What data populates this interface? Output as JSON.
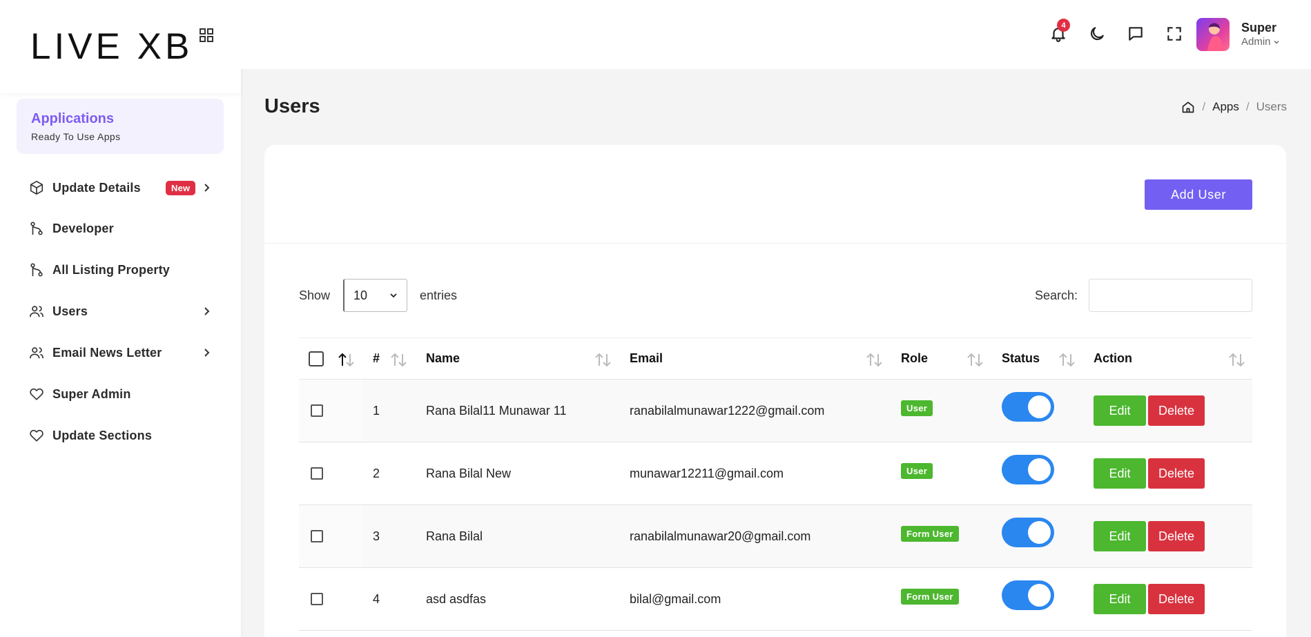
{
  "brand": {
    "logo_text": "LIVE XB"
  },
  "sidebar": {
    "apps_title": "Applications",
    "apps_subtitle": "Ready To Use Apps",
    "items": [
      {
        "label": "Update Details",
        "icon": "box-icon",
        "badge": "New",
        "chevron": true
      },
      {
        "label": "Developer",
        "icon": "git-branch-icon",
        "chevron": false
      },
      {
        "label": "All Listing Property",
        "icon": "git-branch-icon",
        "chevron": false
      },
      {
        "label": "Users",
        "icon": "users-icon",
        "chevron": true
      },
      {
        "label": "Email News Letter",
        "icon": "users-icon",
        "chevron": true
      },
      {
        "label": "Super Admin",
        "icon": "heart-icon",
        "chevron": false
      },
      {
        "label": "Update Sections",
        "icon": "heart-icon",
        "chevron": false
      }
    ]
  },
  "header": {
    "notification_count": "4",
    "user_name": "Super",
    "user_role": "Admin"
  },
  "page": {
    "title": "Users",
    "breadcrumb": [
      "Apps",
      "Users"
    ]
  },
  "card": {
    "add_button": "Add User",
    "show_label": "Show",
    "entries_value": "10",
    "entries_label": "entries",
    "search_label": "Search:",
    "search_value": ""
  },
  "table": {
    "columns": [
      "#",
      "Name",
      "Email",
      "Role",
      "Status",
      "Action"
    ],
    "edit_label": "Edit",
    "delete_label": "Delete",
    "rows": [
      {
        "id": "1",
        "name": "Rana Bilal11 Munawar 11",
        "email": "ranabilalmunawar1222@gmail.com",
        "role": "User",
        "status_on": true
      },
      {
        "id": "2",
        "name": "Rana Bilal New",
        "email": "munawar12211@gmail.com",
        "role": "User",
        "status_on": true
      },
      {
        "id": "3",
        "name": "Rana Bilal",
        "email": "ranabilalmunawar20@gmail.com",
        "role": "Form User",
        "status_on": true
      },
      {
        "id": "4",
        "name": "asd asdfas",
        "email": "bilal@gmail.com",
        "role": "Form User",
        "status_on": true
      }
    ]
  },
  "colors": {
    "accent": "#7360f2",
    "edit": "#4cb72f",
    "delete": "#d9323f",
    "toggle": "#2a87f0",
    "badge": "#e02f44"
  }
}
